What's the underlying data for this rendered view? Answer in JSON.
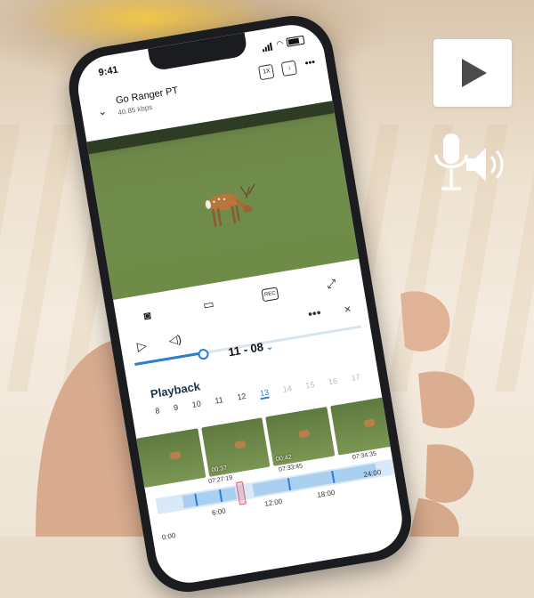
{
  "colors": {
    "accent": "#2a7fd4",
    "phone_body": "#1b1c1f",
    "marker": "#e15a74"
  },
  "status_bar": {
    "time": "9:41"
  },
  "header": {
    "title": "Go Ranger PT",
    "bitrate": "40.85 kbps",
    "speed_label": "1X"
  },
  "toolbar": {
    "record_label": "REC"
  },
  "controls": {
    "date": "11 - 08",
    "more": "•••",
    "close": "×"
  },
  "playback": {
    "label": "Playback",
    "days": [
      "8",
      "9",
      "10",
      "11",
      "12",
      "13",
      "14",
      "15",
      "16",
      "17"
    ],
    "selected_day": "13",
    "progress": 0.3
  },
  "thumbnails": [
    {
      "caption": ""
    },
    {
      "caption": "00:37"
    },
    {
      "caption": "00:42"
    },
    {
      "caption": ""
    }
  ],
  "clip_times": [
    "07:27:19",
    "07:33:45",
    "07:34:35"
  ],
  "timeline_hours": [
    "6:00",
    "12:00",
    "18:00",
    "24:00"
  ],
  "timeline_start": "0:00",
  "icons": [
    "play-icon",
    "microphone-speaker-icon"
  ]
}
